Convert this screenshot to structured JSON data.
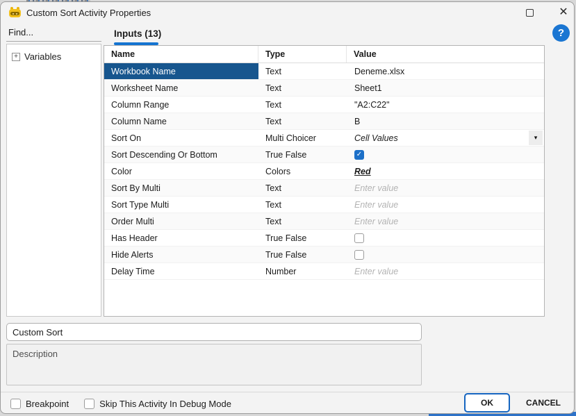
{
  "window": {
    "title": "Custom Sort Activity Properties"
  },
  "icons": {
    "app": "robot-icon",
    "maximize": "maximize-box",
    "close": "✕",
    "help": "?",
    "expander": "+",
    "dropdown": "▾",
    "check": "✓"
  },
  "sidebar": {
    "find_label": "Find...",
    "tree_items": [
      {
        "label": "Variables"
      }
    ]
  },
  "tabs": [
    {
      "label": "Inputs (13)",
      "active": true
    }
  ],
  "table": {
    "columns": [
      "Name",
      "Type",
      "Value"
    ],
    "rows": [
      {
        "name": "Workbook Name",
        "type": "Text",
        "value": "Deneme.xlsx",
        "kind": "text",
        "selected": true
      },
      {
        "name": "Worksheet Name",
        "type": "Text",
        "value": "Sheet1",
        "kind": "text",
        "selected": false
      },
      {
        "name": "Column Range",
        "type": "Text",
        "value": "\"A2:C22\"",
        "kind": "text",
        "selected": false
      },
      {
        "name": "Column Name",
        "type": "Text",
        "value": "B",
        "kind": "text",
        "selected": false
      },
      {
        "name": "Sort On",
        "type": "Multi Choicer",
        "value": "Cell Values",
        "kind": "dropdown",
        "selected": false
      },
      {
        "name": "Sort Descending Or Bottom",
        "type": "True False",
        "value": "checked",
        "kind": "checkbox_checked",
        "selected": false
      },
      {
        "name": "Color",
        "type": "Colors",
        "value": "Red",
        "kind": "link",
        "selected": false
      },
      {
        "name": "Sort By Multi",
        "type": "Text",
        "value": "Enter value",
        "kind": "placeholder",
        "selected": false
      },
      {
        "name": "Sort Type Multi",
        "type": "Text",
        "value": "Enter value",
        "kind": "placeholder",
        "selected": false
      },
      {
        "name": "Order Multi",
        "type": "Text",
        "value": "Enter value",
        "kind": "placeholder",
        "selected": false
      },
      {
        "name": "Has Header",
        "type": "True False",
        "value": "unchecked",
        "kind": "checkbox_unchecked",
        "selected": false
      },
      {
        "name": "Hide Alerts",
        "type": "True False",
        "value": "unchecked",
        "kind": "checkbox_unchecked",
        "selected": false
      },
      {
        "name": "Delay Time",
        "type": "Number",
        "value": "Enter value",
        "kind": "placeholder",
        "selected": false
      }
    ]
  },
  "display_name": {
    "value": "Custom Sort"
  },
  "description": {
    "placeholder": "Description"
  },
  "footer": {
    "breakpoint_label": "Breakpoint",
    "skip_label": "Skip This Activity In Debug Mode",
    "ok_label": "OK",
    "cancel_label": "CANCEL"
  },
  "colors": {
    "accent_blue": "#1574d1",
    "selected_row": "#17568e",
    "checkbox_checked": "#1d70c8",
    "help_circle": "#1b76d2",
    "ok_border": "#1565c0",
    "window_bg": "#f3f3f3",
    "bottom_strip": "#2d72c8"
  }
}
